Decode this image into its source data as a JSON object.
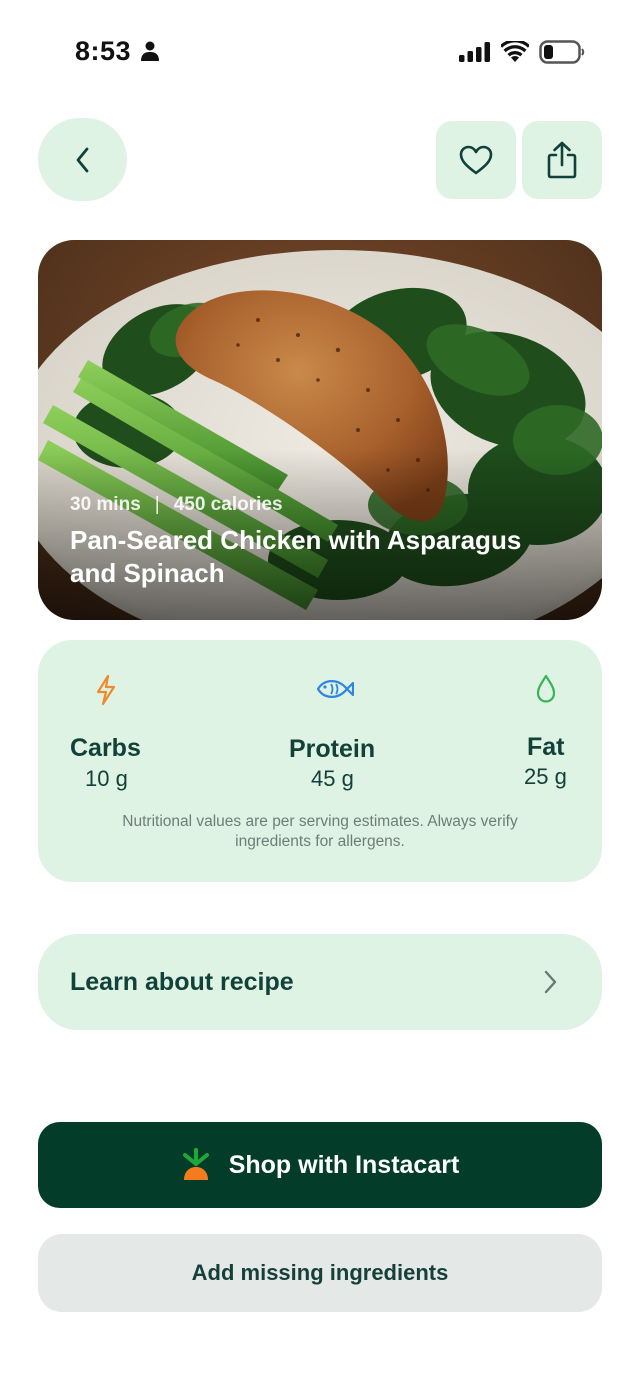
{
  "status_bar": {
    "time": "8:53"
  },
  "header": {
    "back_icon": "chevron-left-icon",
    "favorite_icon": "heart-icon",
    "share_icon": "share-icon"
  },
  "recipe": {
    "time": "30 mins",
    "separator": "|",
    "calories": "450 calories",
    "title": "Pan-Seared Chicken with Asparagus and Spinach"
  },
  "nutrition": {
    "items": [
      {
        "label": "Carbs",
        "value": "10 g",
        "icon": "lightning-icon",
        "icon_color": "#f08a2a"
      },
      {
        "label": "Protein",
        "value": "45 g",
        "icon": "fish-icon",
        "icon_color": "#2f86e0"
      },
      {
        "label": "Fat",
        "value": "25 g",
        "icon": "droplet-icon",
        "icon_color": "#35b553"
      }
    ],
    "disclaimer": "Nutritional values are per serving estimates. Always verify ingredients for allergens."
  },
  "learn": {
    "label": "Learn about recipe"
  },
  "actions": {
    "shop_label": "Shop with Instacart",
    "add_label": "Add missing ingredients"
  },
  "colors": {
    "accent_light": "#def3e3",
    "primary_dark": "#033c28",
    "text_dark": "#12413a"
  }
}
